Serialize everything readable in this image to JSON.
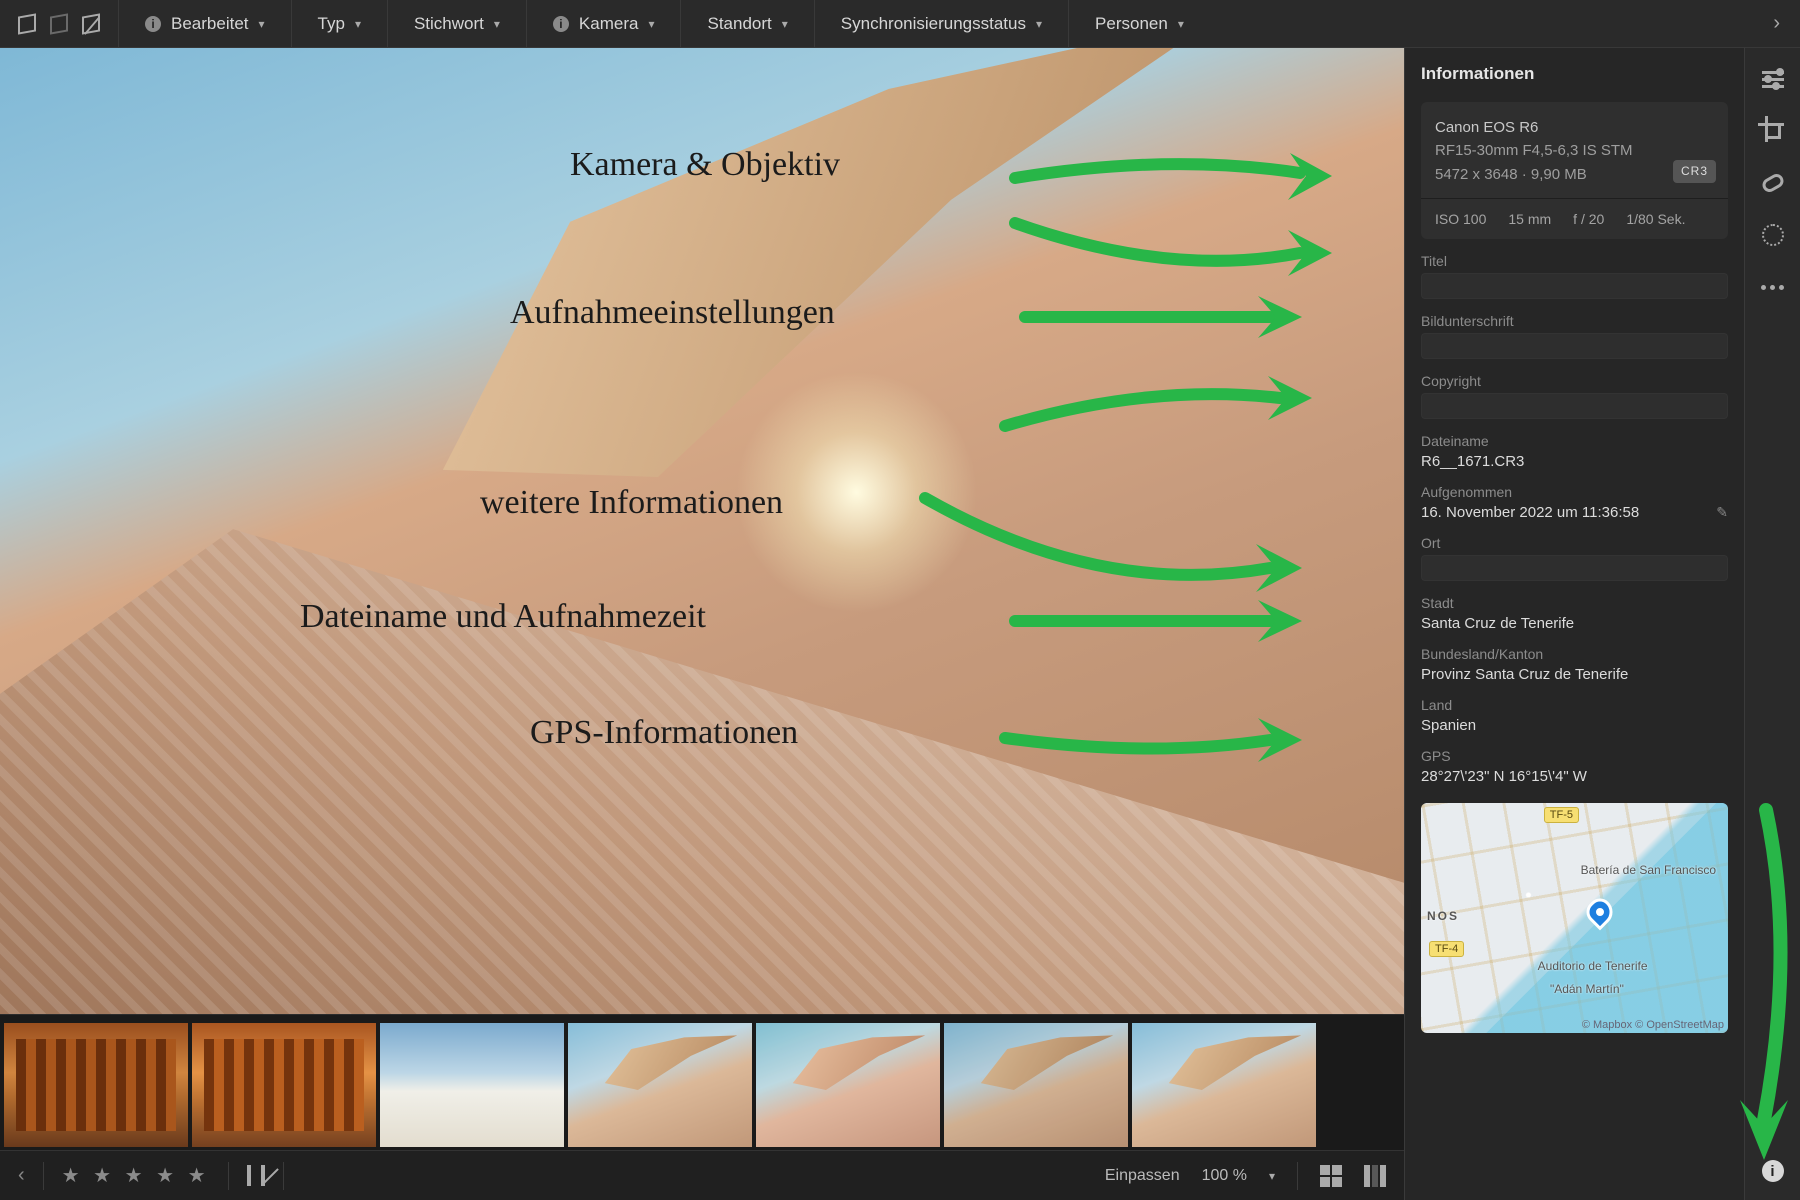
{
  "filters": {
    "bearbeitet": "Bearbeitet",
    "typ": "Typ",
    "stichwort": "Stichwort",
    "kamera": "Kamera",
    "standort": "Standort",
    "sync": "Synchronisierungsstatus",
    "personen": "Personen"
  },
  "panel_title": "Informationen",
  "camera": {
    "model": "Canon EOS R6",
    "lens": "RF15-30mm F4,5-6,3 IS STM",
    "dims_size": "5472 x 3648  ·  9,90 MB",
    "format_badge": "CR3",
    "iso": "ISO 100",
    "focal": "15 mm",
    "aperture": "f / 20",
    "shutter": "1/80 Sek."
  },
  "fields": {
    "titel_label": "Titel",
    "bildunterschrift_label": "Bildunterschrift",
    "copyright_label": "Copyright",
    "dateiname_label": "Dateiname",
    "dateiname": "R6__1671.CR3",
    "aufgenommen_label": "Aufgenommen",
    "aufgenommen": "16. November 2022 um 11:36:58",
    "ort_label": "Ort",
    "stadt_label": "Stadt",
    "stadt": "Santa Cruz de Tenerife",
    "bundesland_label": "Bundesland/Kanton",
    "bundesland": "Provinz Santa Cruz de Tenerife",
    "land_label": "Land",
    "land": "Spanien",
    "gps_label": "GPS",
    "gps": "28°27\\'23\" N 16°15\\'4\" W"
  },
  "map": {
    "place1": "Batería de San Francisco",
    "place2": "Auditorio de Tenerife",
    "place3": "\"Adán Martín\"",
    "area": "NOS",
    "road1": "TF-5",
    "road2": "TF-4",
    "attr": "© Mapbox © OpenStreetMap"
  },
  "status": {
    "fit": "Einpassen",
    "zoom": "100 %"
  },
  "annotations": {
    "a1": "Kamera & Objektiv",
    "a2": "Aufnahmeeinstellungen",
    "a3": "weitere Informationen",
    "a4": "Dateiname und Aufnahmezeit",
    "a5": "GPS-Informationen"
  }
}
